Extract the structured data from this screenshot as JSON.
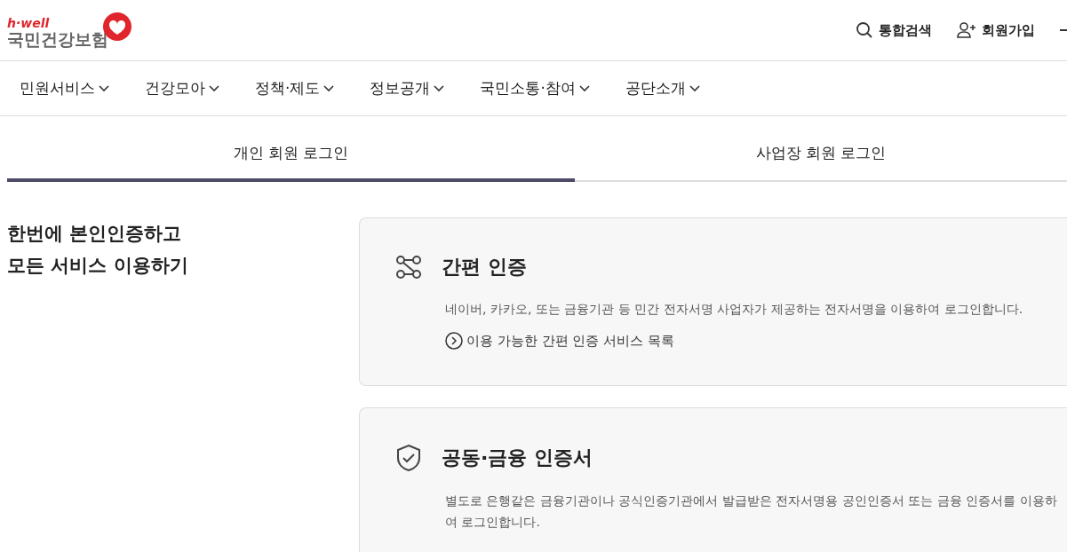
{
  "logo": {
    "tagline": "h·well",
    "name": "국민건강보험"
  },
  "utility_links": [
    {
      "kind": "search",
      "label": "통합검색"
    },
    {
      "kind": "join",
      "label": "회원가입"
    },
    {
      "kind": "cut"
    }
  ],
  "nav": [
    "민원서비스",
    "건강모아",
    "정책·제도",
    "정보공개",
    "국민소통·참여",
    "공단소개"
  ],
  "tabs": [
    {
      "label": "개인 회원 로그인",
      "selected": true
    },
    {
      "label": "사업장 회원 로그인",
      "selected": false
    }
  ],
  "intro": [
    "한번에 본인인증하고",
    "모든 서비스 이용하기"
  ],
  "methods": [
    {
      "kind": "simple",
      "title": "간편 인증",
      "description": "네이버, 카카오, 또는 금융기관 등 민간 전자서명 사업자가 제공하는 전자서명을 이용하여 로그인합니다.",
      "link": "이용 가능한 간편 인증 서비스 목록"
    },
    {
      "kind": "certificate",
      "title": "공동·금융 인증서",
      "description": "별도로 은행같은 금융기관이나 공식인증기관에서 발급받은 전자서명용 공인인증서 또는 금융 인증서를 이용하여 로그인합니다."
    }
  ]
}
